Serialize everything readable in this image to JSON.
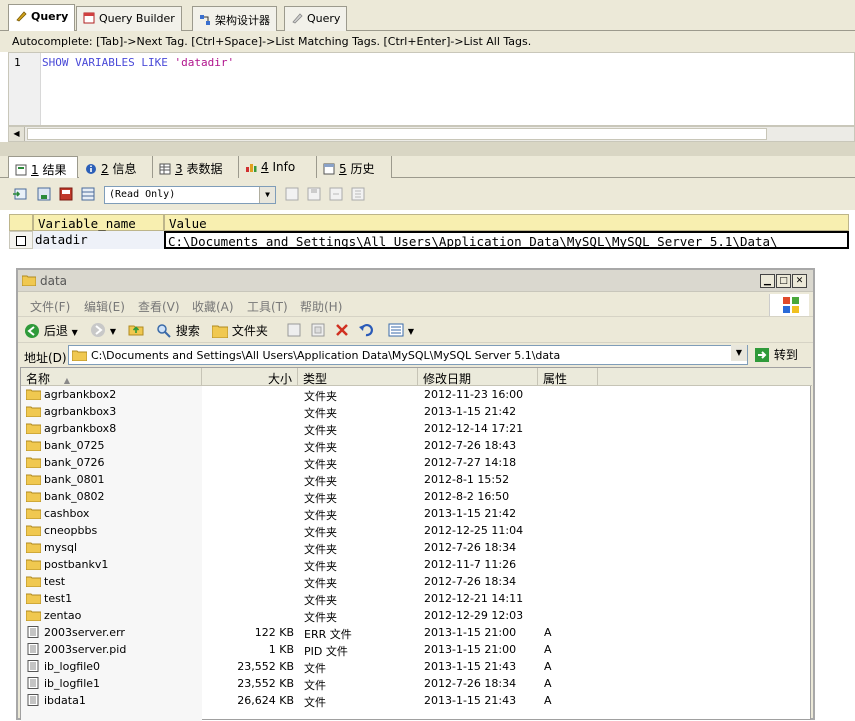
{
  "top_tabs": [
    {
      "label": "Query",
      "icon": "query-icon",
      "active": true
    },
    {
      "label": "Query Builder",
      "icon": "query-builder-icon",
      "active": false
    },
    {
      "label": "架构设计器",
      "icon": "schema-designer-icon",
      "active": false
    },
    {
      "label": "Query",
      "icon": "query-icon",
      "active": false
    }
  ],
  "hint": "Autocomplete: [Tab]->Next Tag. [Ctrl+Space]->List Matching Tags. [Ctrl+Enter]->List All Tags.",
  "editor": {
    "line_number": "1",
    "sql_keywords": "SHOW VARIABLES LIKE",
    "sql_string": "'datadir'"
  },
  "result_tabs": [
    {
      "num": "1",
      "label": "结果",
      "icon": "result-icon"
    },
    {
      "num": "2",
      "label": "信息",
      "icon": "info-icon"
    },
    {
      "num": "3",
      "label": "表数据",
      "icon": "table-data-icon"
    },
    {
      "num": "4",
      "label": "Info",
      "icon": "chart-info-icon"
    },
    {
      "num": "5",
      "label": "历史",
      "icon": "history-icon"
    }
  ],
  "result_mode": "(Read Only)",
  "result_grid": {
    "headers": [
      "Variable_name",
      "Value"
    ],
    "row": [
      "datadir",
      "C:\\Documents and Settings\\All Users\\Application Data\\MySQL\\MySQL Server 5.1\\Data\\"
    ]
  },
  "explorer": {
    "title": "data",
    "menu": [
      "文件(F)",
      "编辑(E)",
      "查看(V)",
      "收藏(A)",
      "工具(T)",
      "帮助(H)"
    ],
    "toolbar": {
      "back": "后退",
      "search": "搜索",
      "folders": "文件夹"
    },
    "address_label": "地址(D)",
    "address": "C:\\Documents and Settings\\All Users\\Application Data\\MySQL\\MySQL Server 5.1\\data",
    "go": "转到",
    "columns": [
      "名称",
      "大小",
      "类型",
      "修改日期",
      "属性"
    ],
    "files": [
      {
        "name": "agrbankbox2",
        "size": "",
        "type": "文件夹",
        "date": "2012-11-23 16:00",
        "attr": "",
        "kind": "folder"
      },
      {
        "name": "agrbankbox3",
        "size": "",
        "type": "文件夹",
        "date": "2013-1-15 21:42",
        "attr": "",
        "kind": "folder"
      },
      {
        "name": "agrbankbox8",
        "size": "",
        "type": "文件夹",
        "date": "2012-12-14 17:21",
        "attr": "",
        "kind": "folder"
      },
      {
        "name": "bank_0725",
        "size": "",
        "type": "文件夹",
        "date": "2012-7-26 18:43",
        "attr": "",
        "kind": "folder"
      },
      {
        "name": "bank_0726",
        "size": "",
        "type": "文件夹",
        "date": "2012-7-27 14:18",
        "attr": "",
        "kind": "folder"
      },
      {
        "name": "bank_0801",
        "size": "",
        "type": "文件夹",
        "date": "2012-8-1 15:52",
        "attr": "",
        "kind": "folder"
      },
      {
        "name": "bank_0802",
        "size": "",
        "type": "文件夹",
        "date": "2012-8-2 16:50",
        "attr": "",
        "kind": "folder"
      },
      {
        "name": "cashbox",
        "size": "",
        "type": "文件夹",
        "date": "2013-1-15 21:42",
        "attr": "",
        "kind": "folder"
      },
      {
        "name": "cneopbbs",
        "size": "",
        "type": "文件夹",
        "date": "2012-12-25 11:04",
        "attr": "",
        "kind": "folder"
      },
      {
        "name": "mysql",
        "size": "",
        "type": "文件夹",
        "date": "2012-7-26 18:34",
        "attr": "",
        "kind": "folder"
      },
      {
        "name": "postbankv1",
        "size": "",
        "type": "文件夹",
        "date": "2012-11-7 11:26",
        "attr": "",
        "kind": "folder"
      },
      {
        "name": "test",
        "size": "",
        "type": "文件夹",
        "date": "2012-7-26 18:34",
        "attr": "",
        "kind": "folder"
      },
      {
        "name": "test1",
        "size": "",
        "type": "文件夹",
        "date": "2012-12-21 14:11",
        "attr": "",
        "kind": "folder"
      },
      {
        "name": "zentao",
        "size": "",
        "type": "文件夹",
        "date": "2012-12-29 12:03",
        "attr": "",
        "kind": "folder"
      },
      {
        "name": "2003server.err",
        "size": "122 KB",
        "type": "ERR 文件",
        "date": "2013-1-15 21:00",
        "attr": "A",
        "kind": "file"
      },
      {
        "name": "2003server.pid",
        "size": "1 KB",
        "type": "PID 文件",
        "date": "2013-1-15 21:00",
        "attr": "A",
        "kind": "file"
      },
      {
        "name": "ib_logfile0",
        "size": "23,552 KB",
        "type": "文件",
        "date": "2013-1-15 21:43",
        "attr": "A",
        "kind": "file"
      },
      {
        "name": "ib_logfile1",
        "size": "23,552 KB",
        "type": "文件",
        "date": "2012-7-26 18:34",
        "attr": "A",
        "kind": "file"
      },
      {
        "name": "ibdata1",
        "size": "26,624 KB",
        "type": "文件",
        "date": "2013-1-15 21:43",
        "attr": "A",
        "kind": "file"
      }
    ]
  }
}
